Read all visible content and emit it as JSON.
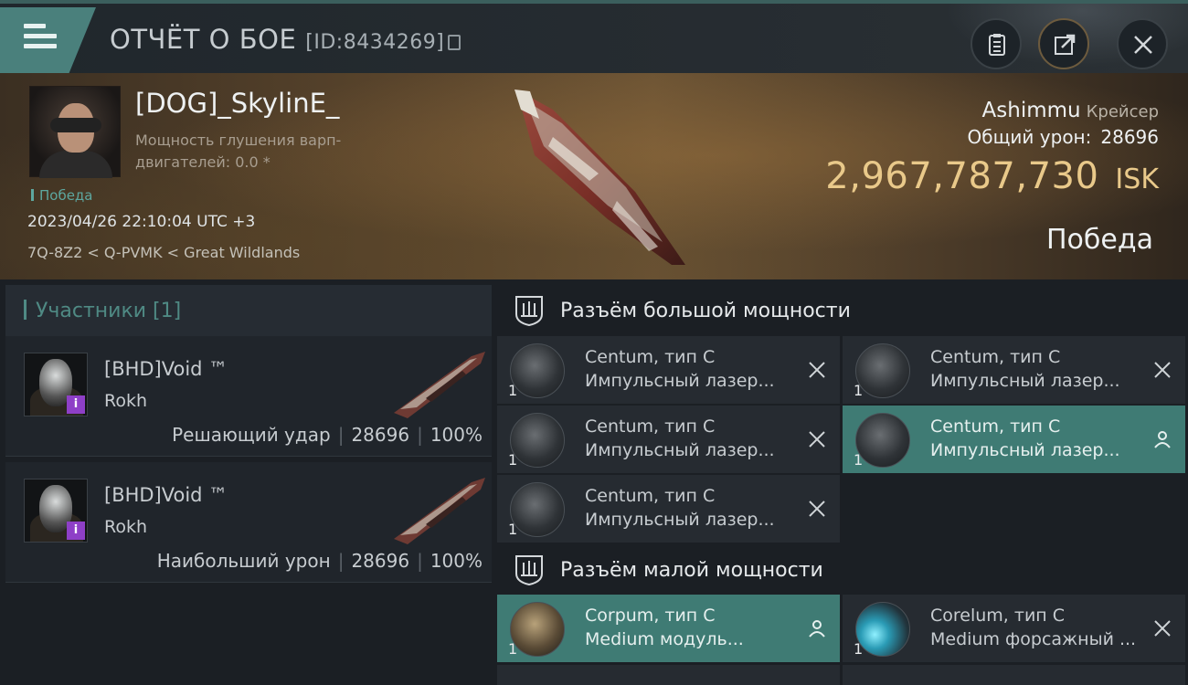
{
  "header": {
    "title": "ОТЧЁТ О БОЕ",
    "report_id": "[ID:8434269]",
    "buttons": [
      "clipboard-icon",
      "share-icon",
      "close-icon"
    ]
  },
  "victim": {
    "pilot_name": "[DOG]_SkylinE_",
    "warp_scramble_label": "Мощность глушения варп-двигателей: 0.0 *",
    "outcome_tag": "Победа",
    "datetime": "2023/04/26 22:10:04 UTC +3",
    "location": "7Q-8Z2 < Q-PVMK < Great Wildlands",
    "ship_name": "Ashimmu",
    "ship_class": "Крейсер",
    "total_damage_label": "Общий урон:",
    "total_damage": "28696",
    "isk_value": "2,967,787,730",
    "isk_currency": "ISK",
    "result": "Победа"
  },
  "participants": {
    "header": "Участники [1]",
    "items": [
      {
        "name": "[BHD]Void ™",
        "ship": "Rokh",
        "role": "Решающий удар",
        "damage": "28696",
        "percent": "100%"
      },
      {
        "name": "[BHD]Void ™",
        "ship": "Rokh",
        "role": "Наибольший урон",
        "damage": "28696",
        "percent": "100%"
      }
    ]
  },
  "slots": {
    "high_power": {
      "title": "Разъём большой мощности",
      "modules": [
        {
          "qty": "1",
          "name": "Centum, тип C",
          "type": "Импульсный лазер...",
          "status": "destroyed-x-icon",
          "active": false
        },
        {
          "qty": "1",
          "name": "Centum, тип C",
          "type": "Импульсный лазер...",
          "status": "destroyed-x-icon",
          "active": false
        },
        {
          "qty": "1",
          "name": "Centum, тип C",
          "type": "Импульсный лазер...",
          "status": "destroyed-x-icon",
          "active": false
        },
        {
          "qty": "1",
          "name": "Centum, тип C",
          "type": "Импульсный лазер...",
          "status": "dropped-person-icon",
          "active": true
        },
        {
          "qty": "1",
          "name": "Centum, тип C",
          "type": "Импульсный лазер...",
          "status": "destroyed-x-icon",
          "active": false
        }
      ]
    },
    "medium_power": {
      "title": "Разъём малой мощности",
      "modules": [
        {
          "qty": "1",
          "name": "Corpum, тип C",
          "type": "Medium модуль...",
          "status": "dropped-person-icon",
          "active": true
        },
        {
          "qty": "1",
          "name": "Corelum, тип C",
          "type": "Medium форсажный ...",
          "status": "destroyed-x-icon",
          "active": false
        }
      ]
    }
  },
  "colors": {
    "accent_teal": "#4a807c",
    "active_module": "#3f7b74",
    "isk_gold": "#e9c98a",
    "corp_badge": "#8e3fc7"
  }
}
